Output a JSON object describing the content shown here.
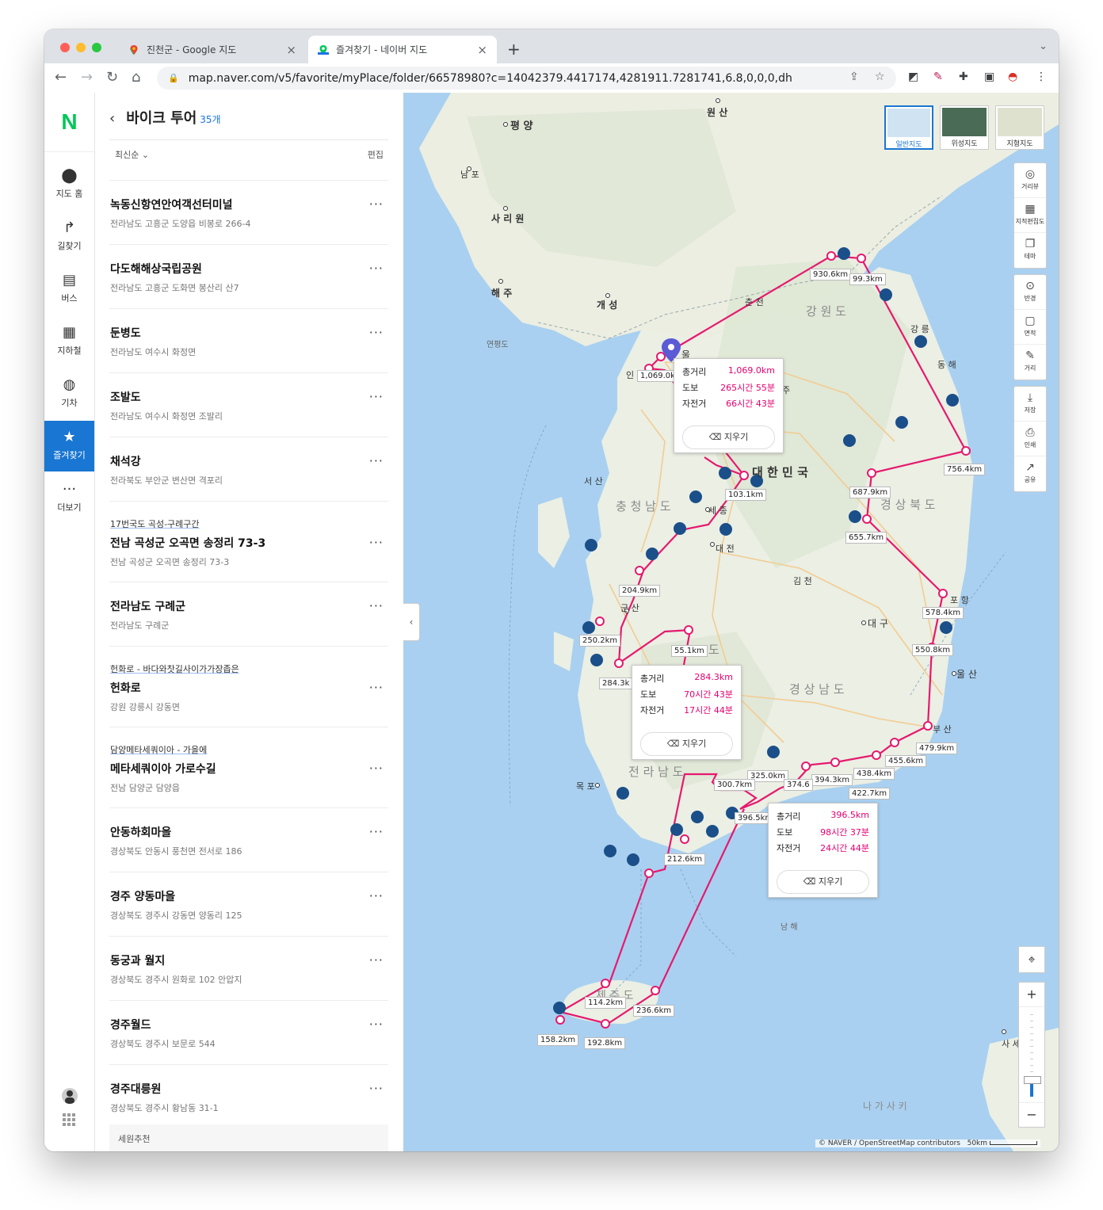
{
  "browser": {
    "tabs": [
      {
        "title": "진천군 - Google 지도",
        "close": "×"
      },
      {
        "title": "즐겨찾기 - 네이버 지도",
        "close": "×"
      }
    ],
    "new_tab": "+",
    "url": "map.naver.com/v5/favorite/myPlace/folder/66578980?c=14042379.4417174,4281911.7281741,6.8,0,0,0,dh"
  },
  "nav": {
    "logo": "N",
    "items": [
      {
        "label": "지도 홈",
        "icon": "map-pin-icon"
      },
      {
        "label": "길찾기",
        "icon": "directions-icon"
      },
      {
        "label": "버스",
        "icon": "bus-icon"
      },
      {
        "label": "지하철",
        "icon": "subway-icon"
      },
      {
        "label": "기차",
        "icon": "train-icon"
      },
      {
        "label": "즐겨찾기",
        "icon": "star-icon"
      },
      {
        "label": "더보기",
        "icon": "more-icon"
      }
    ]
  },
  "panel": {
    "title": "바이크 투어",
    "count": "35개",
    "sort": "최신순",
    "edit": "편집",
    "items": [
      {
        "tag": "",
        "name": "녹동신항연안여객선터미널",
        "address": "전라남도 고흥군 도양읍 비봉로 266-4"
      },
      {
        "tag": "",
        "name": "다도해해상국립공원",
        "address": "전라남도 고흥군 도화면 봉산리 산7"
      },
      {
        "tag": "",
        "name": "둔병도",
        "address": "전라남도 여수시 화정면"
      },
      {
        "tag": "",
        "name": "조발도",
        "address": "전라남도 여수시 화정면 조발리"
      },
      {
        "tag": "",
        "name": "채석강",
        "address": "전라북도 부안군 변산면 격포리"
      },
      {
        "tag": "17번국도 곡성-구례구간",
        "name": "전남 곡성군 오곡면 송정리 73-3",
        "address": "전남 곡성군 오곡면 송정리 73-3"
      },
      {
        "tag": "",
        "name": "전라남도 구례군",
        "address": "전라남도 구례군"
      },
      {
        "tag": "헌화로 - 바다와찻길사이가가장좁은",
        "name": "헌화로",
        "address": "강원 강릉시 강동면"
      },
      {
        "tag": "담양메타세쿼이아 - 가을에",
        "name": "메타세쿼이아 가로수길",
        "address": "전남 담양군 담양읍"
      },
      {
        "tag": "",
        "name": "안동하회마을",
        "address": "경상북도 안동시 풍천면 전서로 186"
      },
      {
        "tag": "",
        "name": "경주 양동마을",
        "address": "경상북도 경주시 강동면 양동리 125"
      },
      {
        "tag": "",
        "name": "동궁과 월지",
        "address": "경상북도 경주시 원화로 102 안압지"
      },
      {
        "tag": "",
        "name": "경주월드",
        "address": "경상북도 경주시 보문로 544"
      },
      {
        "tag": "",
        "name": "경주대릉원",
        "address": "경상북도 경주시 황남동 31-1"
      }
    ],
    "more_label": "···",
    "recommend": "세원추천"
  },
  "map": {
    "map_types": [
      "일반지도",
      "위성지도",
      "지형지도"
    ],
    "tools_group1": [
      "거리뷰",
      "지적편집도",
      "테마"
    ],
    "tools_group2": [
      "반경",
      "면적",
      "거리"
    ],
    "tools_group3": [
      "저장",
      "인쇄",
      "공유"
    ],
    "place_labels": [
      {
        "text": "평 양"
      },
      {
        "text": "원 산"
      },
      {
        "text": "남 포"
      },
      {
        "text": "사 리 원"
      },
      {
        "text": "해 주"
      },
      {
        "text": "개 성"
      },
      {
        "text": "연평도"
      },
      {
        "text": "춘 천"
      },
      {
        "text": "강 원 도"
      },
      {
        "text": "강 릉"
      },
      {
        "text": "동 해"
      },
      {
        "text": "서 산"
      },
      {
        "text": "충 청 남 도"
      },
      {
        "text": "세 종"
      },
      {
        "text": "대 전"
      },
      {
        "text": "대 한 민 국"
      },
      {
        "text": "경 상 북 도"
      },
      {
        "text": "김 천"
      },
      {
        "text": "대 구"
      },
      {
        "text": "포 항"
      },
      {
        "text": "군 산"
      },
      {
        "text": "경 상 남 도"
      },
      {
        "text": "울 산"
      },
      {
        "text": "전 라 남 도"
      },
      {
        "text": "목 포"
      },
      {
        "text": "부 산"
      },
      {
        "text": "남 해"
      },
      {
        "text": "제 주 도"
      },
      {
        "text": "사 세 보"
      },
      {
        "text": "나 가 사 키"
      },
      {
        "text": "인"
      },
      {
        "text": "울"
      },
      {
        "text": "주"
      },
      {
        "text": "도"
      }
    ],
    "distance_labels": [
      "930.6km",
      "99.3km",
      "1,069.0k",
      "756.4km",
      "687.9km",
      "103.1km",
      "655.7km",
      "204.9km",
      "578.4km",
      "250.2km",
      "55.1km",
      "550.8km",
      "284.3k",
      "479.9km",
      "455.6km",
      "325.0km",
      "394.3km",
      "438.4km",
      "300.7km",
      "374.6",
      "422.7km",
      "396.5km",
      "212.6km",
      "114.2km",
      "236.6km",
      "158.2km",
      "192.8km"
    ],
    "popups": [
      {
        "rows": [
          {
            "k": "총거리",
            "v": "1,069.0km"
          },
          {
            "k": "도보",
            "v": "265시간 55분"
          },
          {
            "k": "자전거",
            "v": "66시간 43분"
          }
        ],
        "clear": "지우기"
      },
      {
        "rows": [
          {
            "k": "총거리",
            "v": "284.3km"
          },
          {
            "k": "도보",
            "v": "70시간 43분"
          },
          {
            "k": "자전거",
            "v": "17시간 44분"
          }
        ],
        "clear": "지우기"
      },
      {
        "rows": [
          {
            "k": "총거리",
            "v": "396.5km"
          },
          {
            "k": "도보",
            "v": "98시간 37분"
          },
          {
            "k": "자전거",
            "v": "24시간 44분"
          }
        ],
        "clear": "지우기"
      }
    ],
    "zoom_in": "+",
    "zoom_out": "−",
    "credit": "© NAVER / OpenStreetMap contributors",
    "scale": "50km",
    "colors": {
      "route": "#e6196e",
      "sea": "#a9d0f0",
      "land": "#eef0e6",
      "marker": "#1b4f8a"
    }
  }
}
